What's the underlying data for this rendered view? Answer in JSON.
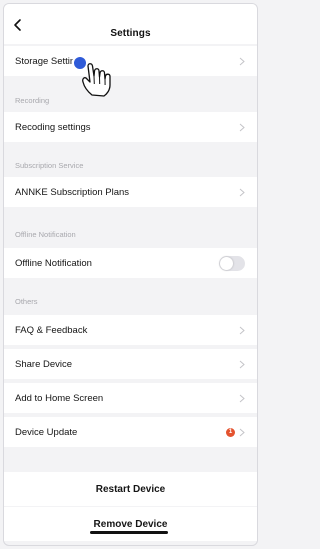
{
  "header": {
    "title": "Settings"
  },
  "storage": {
    "label": "Storage Settings"
  },
  "recording": {
    "section_label": "Recording",
    "row_label": "Recoding settings"
  },
  "subscription": {
    "section_label": "Subscription Service",
    "row_label": "ANNKE Subscription Plans"
  },
  "offline": {
    "section_label": "Offline Notification",
    "row_label": "Offline Notification",
    "enabled": false
  },
  "others": {
    "section_label": "Others",
    "faq_label": "FAQ & Feedback",
    "share_label": "Share Device",
    "home_label": "Add to Home Screen",
    "update_label": "Device Update",
    "update_badge": "1"
  },
  "actions": {
    "restart_label": "Restart Device",
    "remove_label": "Remove Device"
  },
  "colors": {
    "badge": "#e4532f",
    "tap_indicator": "#2f5bd8",
    "toggle_off": "#e3e3e8"
  }
}
